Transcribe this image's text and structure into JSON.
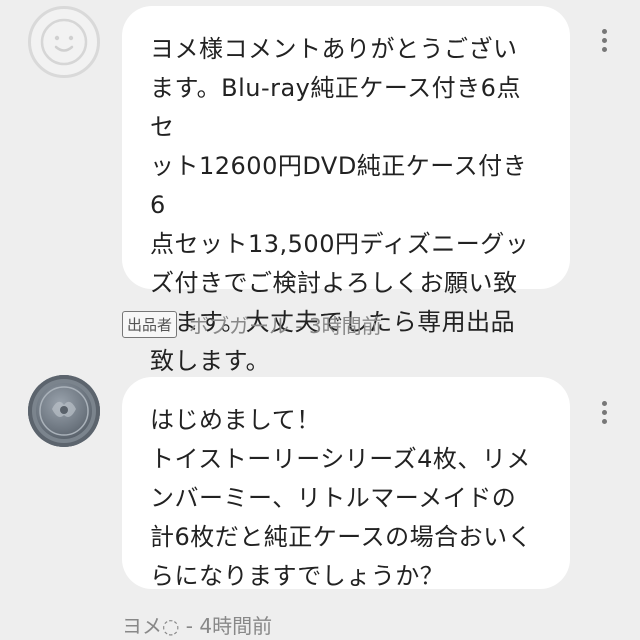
{
  "comments": [
    {
      "avatar": "smiley-face-default-avatar",
      "text": "ヨメ様コメントありがとうござい\nます。Blu-ray純正ケース付き6点セ\nット12600円DVD純正ケース付き6\n点セット13,500円ディズニーグッ\nズ付きでご検討よろしくお願い致\nします。大丈夫でしたら専用出品\n致します。",
      "badge": "出品者",
      "meta": "ボブガール - 3時間前"
    },
    {
      "avatar": "coin-photo-avatar",
      "text": "はじめまして！\nトイストーリーシリーズ4枚、リメ\nンバーミー、リトルマーメイドの\n計6枚だと純正ケースの場合おいく\nらになりますでしょうか？",
      "meta": "ヨメ◌ - 4時間前"
    }
  ]
}
